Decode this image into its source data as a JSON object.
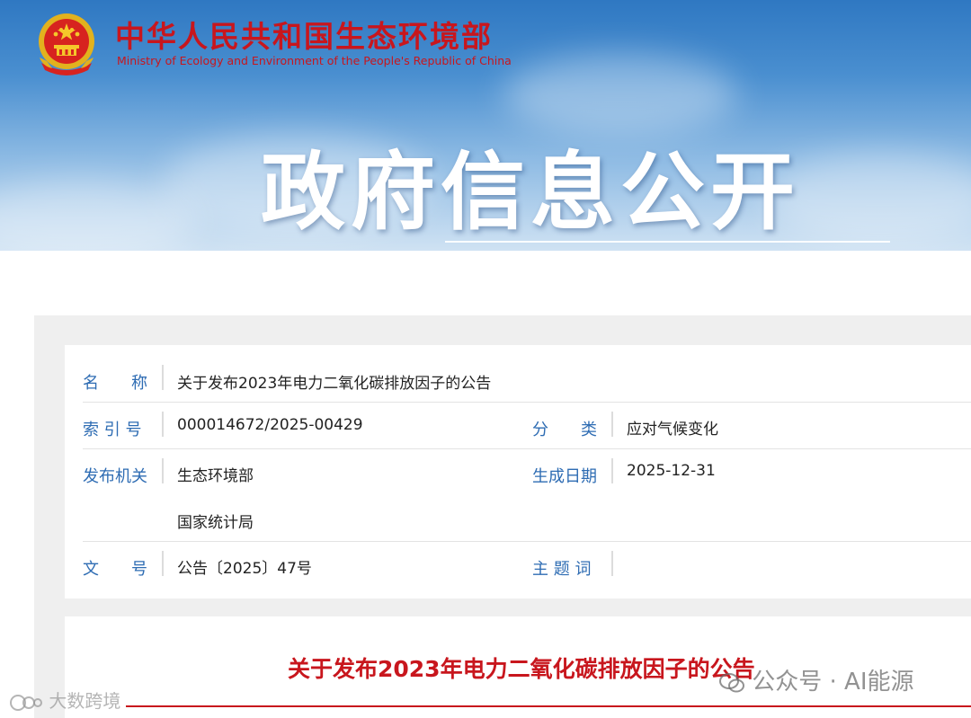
{
  "header": {
    "site_name_cn": "中华人民共和国生态环境部",
    "site_name_en": "Ministry of Ecology and Environment of the People's Republic of China",
    "section_title": "政府信息公开"
  },
  "info": {
    "name_label": "名　　称",
    "name_value": "关于发布2023年电力二氧化碳排放因子的公告",
    "index_label": "索 引 号",
    "index_value": "000014672/2025-00429",
    "category_label": "分　　类",
    "category_value": "应对气候变化",
    "issuer_label": "发布机关",
    "issuer_values": [
      "生态环境部",
      "国家统计局"
    ],
    "date_label": "生成日期",
    "date_value": "2025-12-31",
    "docno_label": "文　　号",
    "docno_value": "公告〔2025〕47号",
    "keywords_label": "主 题 词",
    "keywords_value": ""
  },
  "document": {
    "title": "关于发布2023年电力二氧化碳排放因子的公告"
  },
  "watermarks": {
    "right": "公众号 · AI能源",
    "left": "大数跨境"
  },
  "colors": {
    "brand_red": "#c8161d",
    "label_blue": "#2e6cb3",
    "banner_blue": "#3d84c9"
  }
}
